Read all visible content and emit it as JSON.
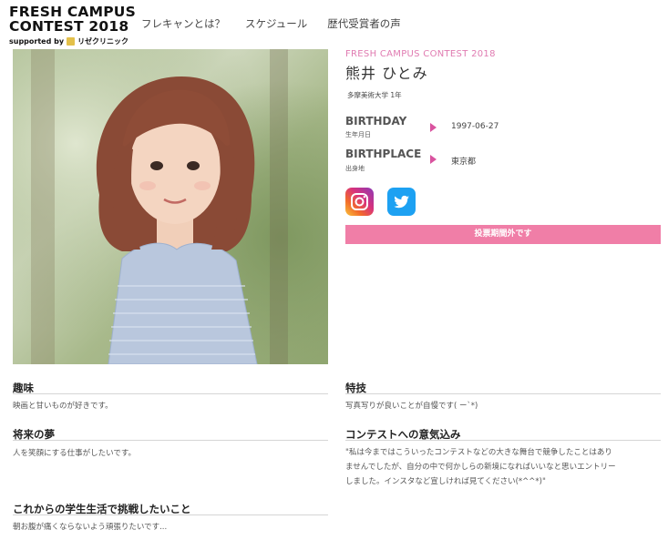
{
  "header": {
    "logo_line1": "FRESH CAMPUS",
    "logo_line2": "CONTEST 2018",
    "logo_sub": "supported by",
    "logo_sponsor": "リゼクリニック",
    "nav": [
      "フレキャンとは？",
      "スケジュール",
      "歴代受賞者の声"
    ]
  },
  "profile": {
    "contest": "FRESH CAMPUS CONTEST 2018",
    "name": "熊井 ひとみ",
    "school": "多摩美術大学 1年",
    "birthday_label": "BIRTHDAY",
    "birthday_sub": "生年月日",
    "birthday_value": "1997-06-27",
    "birthplace_label": "BIRTHPLACE",
    "birthplace_sub": "出身地",
    "birthplace_value": "東京都",
    "vote_label": "投票期間外です"
  },
  "sections": {
    "hobby_title": "趣味",
    "hobby_text": "映画と甘いものが好きです。",
    "skill_title": "特技",
    "skill_text": "写真写りが良いことが自慢です( ー`*)",
    "dream_title": "将来の夢",
    "dream_text": "人を笑顔にする仕事がしたいです。",
    "motivation_title": "コンテストへの意気込み",
    "motivation_text_1": "\"私は今まではこういったコンテストなどの大きな舞台で競争したことはあり",
    "motivation_text_2": "ませんでしたが、自分の中で何かしらの新境になればいいなと思いエントリー",
    "motivation_text_3": "しました。インスタなど宣しければ見てください(*^^*)\"",
    "challenge_title": "これからの学生生活で挑戦したいこと",
    "challenge_text": "朝お腹が痛くならないよう頑張りたいです..."
  },
  "colors": {
    "accent_pink": "#e07bb1",
    "vote_button": "#f07ea7",
    "arrow": "#d9539f",
    "twitter": "#1da1f2"
  },
  "icons": {
    "instagram": "instagram-icon",
    "twitter": "twitter-icon"
  }
}
